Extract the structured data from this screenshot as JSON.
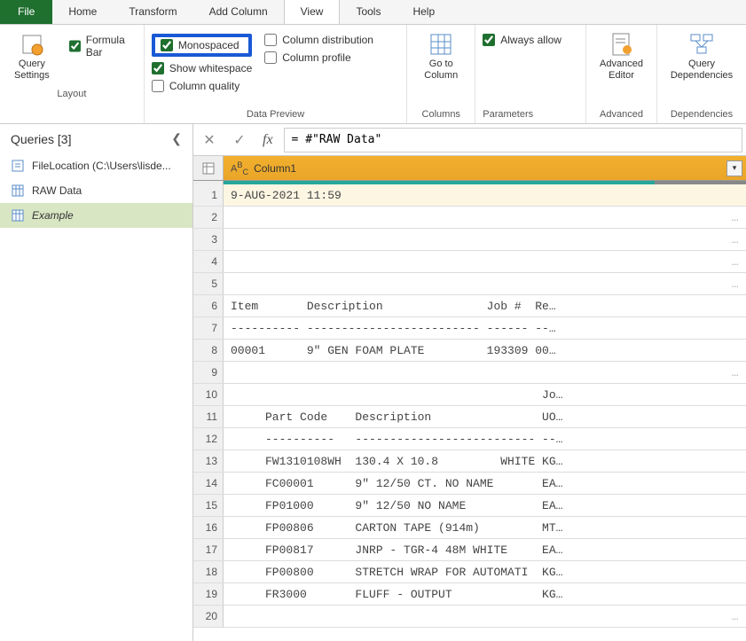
{
  "menu": {
    "file": "File",
    "home": "Home",
    "transform": "Transform",
    "add_column": "Add Column",
    "view": "View",
    "tools": "Tools",
    "help": "Help"
  },
  "ribbon": {
    "layout": {
      "query_settings": "Query\nSettings",
      "formula_bar": "Formula Bar",
      "label": "Layout"
    },
    "data_preview": {
      "monospaced": "Monospaced",
      "show_whitespace": "Show whitespace",
      "column_quality": "Column quality",
      "column_distribution": "Column distribution",
      "column_profile": "Column profile",
      "label": "Data Preview"
    },
    "columns": {
      "go_to_column": "Go to\nColumn",
      "label": "Columns"
    },
    "parameters": {
      "always_allow": "Always allow",
      "label": "Parameters"
    },
    "advanced": {
      "advanced_editor": "Advanced\nEditor",
      "label": "Advanced"
    },
    "dependencies": {
      "query_dependencies": "Query\nDependencies",
      "label": "Dependencies"
    }
  },
  "queries": {
    "title": "Queries [3]",
    "items": [
      {
        "label": "FileLocation (C:\\Users\\lisde..."
      },
      {
        "label": "RAW Data"
      },
      {
        "label": "Example"
      }
    ]
  },
  "formula": "= #\"RAW Data\"",
  "column": {
    "name": "Column1",
    "type_icon": "ABC"
  },
  "rows": [
    "9-AUG-2021 11:59",
    null,
    null,
    null,
    null,
    "Item       Description               Job #  Re…",
    "---------- ------------------------- ------ --…",
    "00001      9\" GEN FOAM PLATE         193309 00…",
    null,
    "                                             Jo…",
    "     Part Code    Description                UO…",
    "     ----------   -------------------------- --…",
    "     FW1310108WH  130.4 X 10.8         WHITE KG…",
    "     FC00001      9\" 12/50 CT. NO NAME       EA…",
    "     FP01000      9\" 12/50 NO NAME           EA…",
    "     FP00806      CARTON TAPE (914m)         MT…",
    "     FP00817      JNRP - TGR-4 48M WHITE     EA…",
    "     FP00800      STRETCH WRAP FOR AUTOMATI  KG…",
    "     FR3000       FLUFF - OUTPUT             KG…",
    null
  ],
  "chart_data": null
}
